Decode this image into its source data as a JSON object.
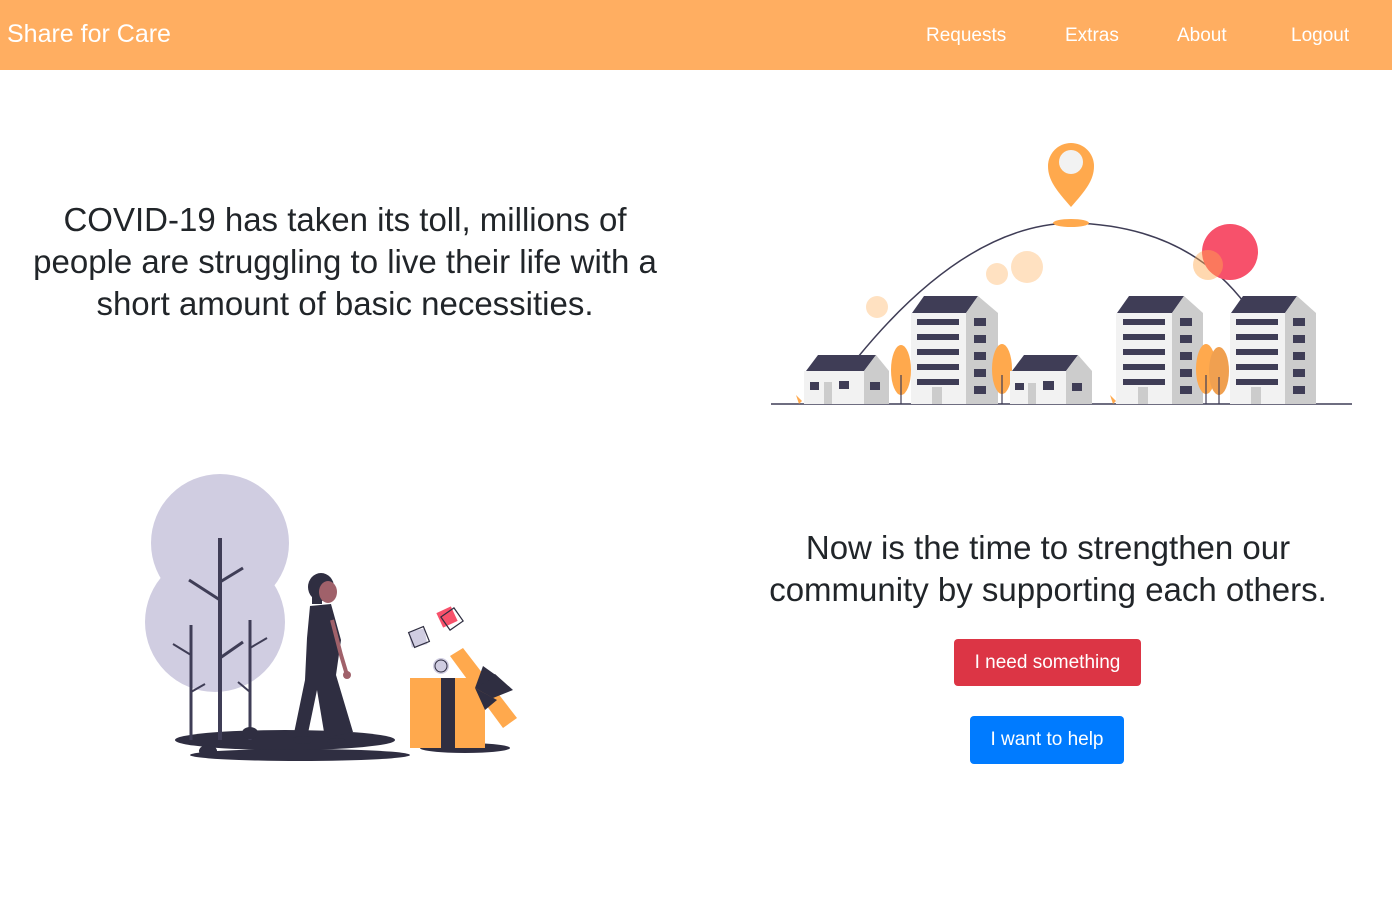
{
  "navbar": {
    "brand": "Share for Care",
    "links": [
      "Requests",
      "Extras",
      "About",
      "Logout"
    ]
  },
  "hero": {
    "headline": "COVID-19 has taken its toll, millions of people are struggling to live their life with a short amount of basic necessities."
  },
  "cta": {
    "headline": "Now is the time to strengthen our community by supporting each others.",
    "need_button": "I need something",
    "help_button": "I want to help"
  },
  "colors": {
    "navbar": "#ffae61",
    "accent_orange": "#ffa94d",
    "need_button": "#dc3545",
    "help_button": "#007bff",
    "dark_figure": "#2f2e41",
    "tree_lavender": "#d0cde1",
    "pink": "#f7516b"
  },
  "illustrations": {
    "city": "city-location-illustration",
    "gift": "woman-gift-illustration"
  }
}
